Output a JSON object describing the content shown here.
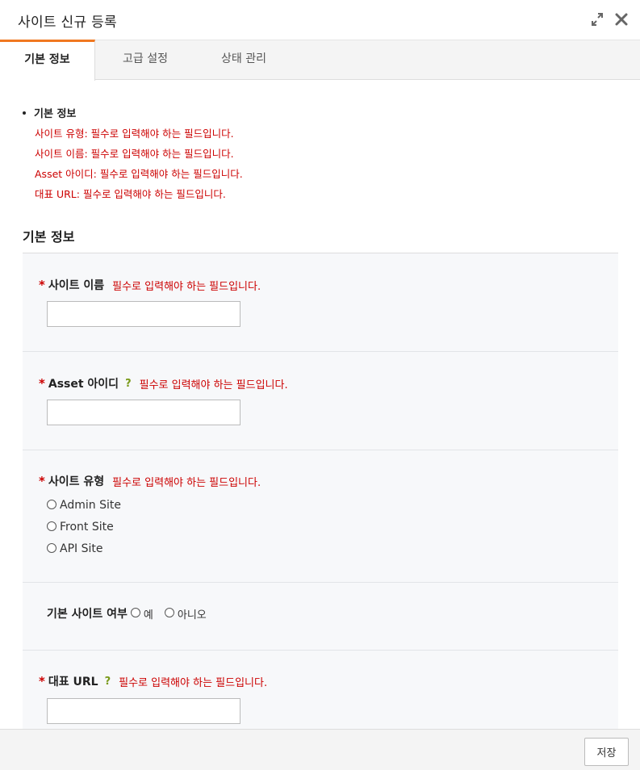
{
  "window": {
    "title": "사이트 신규 등록"
  },
  "tabs": [
    {
      "label": "기본 정보"
    },
    {
      "label": "고급 설정"
    },
    {
      "label": "상태 관리"
    }
  ],
  "error_summary": {
    "heading": "기본 정보",
    "items": [
      "사이트 유형: 필수로 입력해야 하는 필드입니다.",
      "사이트 이름: 필수로 입력해야 하는 필드입니다.",
      "Asset 아이디: 필수로 입력해야 하는 필드입니다.",
      "대표 URL: 필수로 입력해야 하는 필드입니다."
    ]
  },
  "section_title": "기본 정보",
  "fields": {
    "required_mark": "*",
    "help_mark": "?",
    "site_name": {
      "label": "사이트 이름",
      "error": "필수로 입력해야 하는 필드입니다.",
      "value": ""
    },
    "asset_id": {
      "label": "Asset 아이디",
      "error": "필수로 입력해야 하는 필드입니다.",
      "value": ""
    },
    "site_type": {
      "label": "사이트 유형",
      "error": "필수로 입력해야 하는 필드입니다.",
      "options": [
        "Admin Site",
        "Front Site",
        "API Site"
      ]
    },
    "default_site": {
      "label": "기본 사이트 여부",
      "yes": "예",
      "no": "아니오"
    },
    "main_url": {
      "label": "대표 URL",
      "error": "필수로 입력해야 하는 필드입니다.",
      "value": ""
    }
  },
  "footer": {
    "save_label": "저장"
  },
  "colors": {
    "accent": "#f07820",
    "error": "#cc0000",
    "help": "#7a9a1a"
  }
}
